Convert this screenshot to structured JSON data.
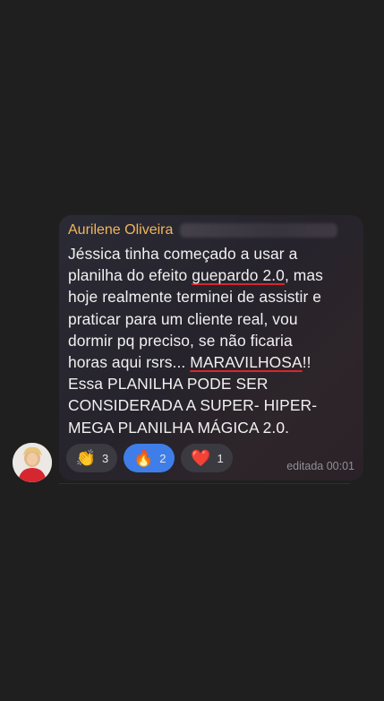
{
  "message": {
    "sender": "Aurilene Oliveira",
    "text_before_1": "Jéssica tinha começado a usar a\nplanilha do efeito ",
    "underlined_1": "guepardo 2.0",
    "text_middle": ", mas\nhoje realmente terminei de assistir e\npraticar para um cliente real, vou\ndormir pq preciso, se não ficaria\nhoras aqui rsrs... ",
    "underlined_2": "MARAVILHOSA",
    "text_after": "!!\nEssa PLANILHA PODE SER\nCONSIDERADA A SUPER- HIPER-\nMEGA PLANILHA MÁGICA 2.0.",
    "edited_label": "editada 00:01"
  },
  "reactions": [
    {
      "emoji": "👏",
      "count": "3",
      "active": false
    },
    {
      "emoji": "🔥",
      "count": "2",
      "active": true
    },
    {
      "emoji": "❤️",
      "count": "1",
      "active": false
    }
  ],
  "colors": {
    "sender": "#f0b65e",
    "active_reaction": "#3f7ee8",
    "underline": "#d8262c"
  }
}
